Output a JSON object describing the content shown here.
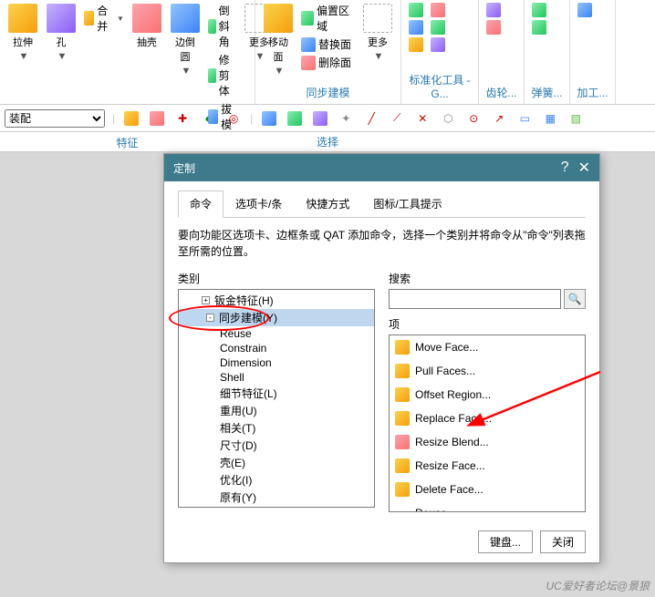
{
  "ribbon": {
    "groups": [
      {
        "label": "特征",
        "large": [
          {
            "name": "extrude-btn",
            "labels": [
              "拉伸"
            ],
            "ic": "cube1"
          },
          {
            "name": "hole-btn",
            "labels": [
              "孔"
            ],
            "ic": "cube2"
          },
          {
            "name": "shell-btn",
            "labels": [
              "抽壳"
            ],
            "ic": "cube4"
          },
          {
            "name": "edge-fillet-btn",
            "labels": [
              "边倒圆"
            ],
            "ic": "cube3"
          }
        ],
        "small": [
          {
            "name": "unite-btn",
            "label": "合并",
            "ic": "cube1"
          },
          {
            "name": "chamfer-btn",
            "label": "倒斜角",
            "ic": "green"
          },
          {
            "name": "trim-body-btn",
            "label": "修剪体",
            "ic": "green"
          },
          {
            "name": "draft-btn",
            "label": "拔模",
            "ic": "cube3"
          }
        ],
        "more": "更多"
      },
      {
        "label": "同步建模",
        "large": [
          {
            "name": "move-face-btn",
            "labels": [
              "移动面"
            ],
            "ic": "cube1"
          }
        ],
        "small": [
          {
            "name": "offset-region-btn",
            "label": "偏置区域",
            "ic": "green"
          },
          {
            "name": "replace-face-btn",
            "label": "替换面",
            "ic": "cube3"
          },
          {
            "name": "delete-face-btn",
            "label": "删除面",
            "ic": "cube4"
          }
        ],
        "more": "更多"
      },
      {
        "label": "标准化工具 - G..."
      },
      {
        "label": "齿轮..."
      },
      {
        "label": "弹簧..."
      },
      {
        "label": "加工..."
      }
    ]
  },
  "secondary": {
    "dropdown": "装配",
    "select_label": "选择"
  },
  "dialog": {
    "title": "定制",
    "tabs": [
      "命令",
      "选项卡/条",
      "快捷方式",
      "图标/工具提示"
    ],
    "active_tab": 0,
    "description": "要向功能区选项卡、边框条或 QAT 添加命令，选择一个类别并将命令从\"命令\"列表拖至所需的位置。",
    "category_label": "类别",
    "search_label": "搜索",
    "items_label": "项",
    "tree": [
      {
        "label": "钣金特征(H)",
        "level": "top",
        "exp": "+"
      },
      {
        "label": "同步建模(Y)",
        "level": "lvl0",
        "exp": "-",
        "selected": true
      },
      {
        "label": "Reuse"
      },
      {
        "label": "Constrain"
      },
      {
        "label": "Dimension"
      },
      {
        "label": "Shell"
      },
      {
        "label": "细节特征(L)"
      },
      {
        "label": "重用(U)"
      },
      {
        "label": "相关(T)"
      },
      {
        "label": "尺寸(D)"
      },
      {
        "label": "壳(E)"
      },
      {
        "label": "优化(I)"
      },
      {
        "label": "原有(Y)"
      }
    ],
    "items": [
      {
        "name": "move-face-item",
        "label": "Move Face...",
        "ic": "cube1"
      },
      {
        "name": "pull-faces-item",
        "label": "Pull Faces...",
        "ic": "cube1"
      },
      {
        "name": "offset-region-item",
        "label": "Offset Region...",
        "ic": "cube1"
      },
      {
        "name": "replace-face-item",
        "label": "Replace Face...",
        "ic": "cube1"
      },
      {
        "name": "resize-blend-item",
        "label": "Resize Blend...",
        "ic": "cube4"
      },
      {
        "name": "resize-face-item",
        "label": "Resize Face...",
        "ic": "cube1"
      },
      {
        "name": "delete-face-item",
        "label": "Delete Face...",
        "ic": "cube1"
      },
      {
        "name": "reuse-item",
        "label": "Reuse",
        "expandable": true
      }
    ],
    "buttons": {
      "keyboard": "键盘...",
      "close": "关闭"
    }
  },
  "watermark": "UC爱好者论坛@景狼"
}
